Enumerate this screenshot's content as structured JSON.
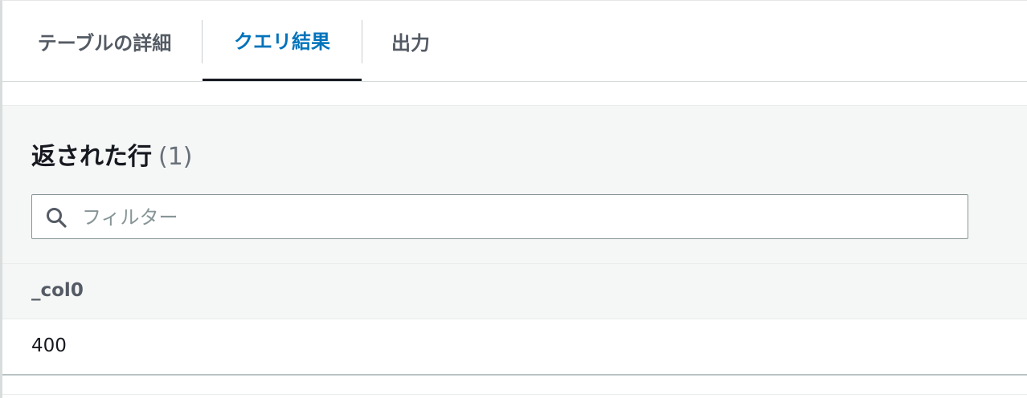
{
  "tabs": [
    {
      "label": "テーブルの詳細",
      "active": false
    },
    {
      "label": "クエリ結果",
      "active": true
    },
    {
      "label": "出力",
      "active": false
    }
  ],
  "results": {
    "heading": "返された行",
    "count": "(1)"
  },
  "filter": {
    "placeholder": "フィルター",
    "value": "",
    "icon": "search-icon"
  },
  "table": {
    "columns": [
      "_col0"
    ],
    "rows": [
      [
        "400"
      ]
    ]
  },
  "colors": {
    "active_tab": "#0073bb",
    "inactive_tab": "#545b64",
    "panel_bg": "#f5f6f6"
  }
}
